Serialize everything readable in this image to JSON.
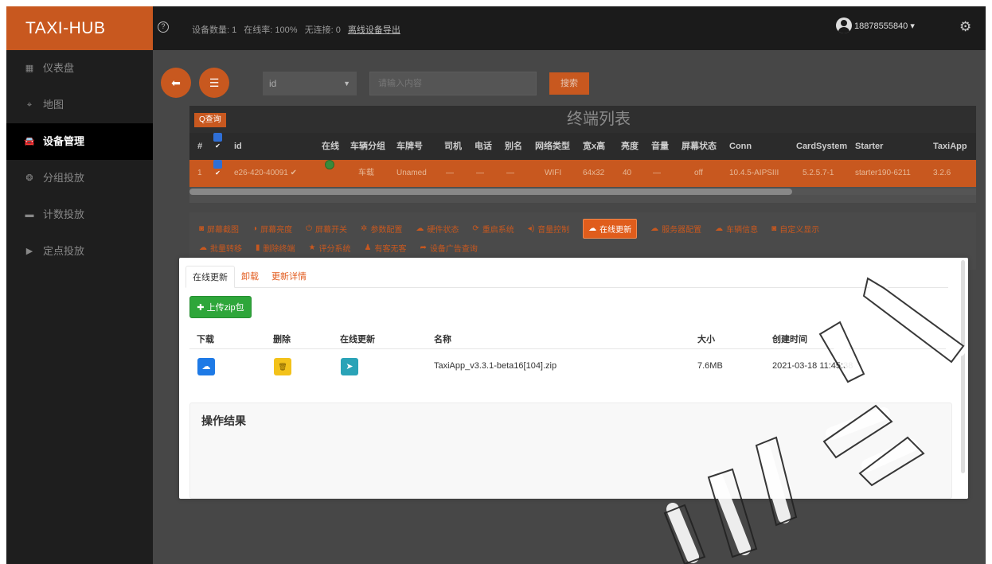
{
  "app": {
    "brand": "TAXI-HUB"
  },
  "header": {
    "device_count": "设备数量: 1",
    "online_rate": "在线率: 100%",
    "no_connect": "无连接: 0",
    "export_link": "离线设备导出",
    "user": "18878555840 ▾"
  },
  "sidebar": {
    "items": [
      {
        "label": "仪表盘",
        "icon": "dashboard-icon",
        "glyph": "▦"
      },
      {
        "label": "地图",
        "icon": "map-icon",
        "glyph": "⌖"
      },
      {
        "label": "设备管理",
        "icon": "car-icon",
        "glyph": "🚘"
      },
      {
        "label": "分组投放",
        "icon": "group-icon",
        "glyph": "❂"
      },
      {
        "label": "计数投放",
        "icon": "card-icon",
        "glyph": "▬"
      },
      {
        "label": "定点投放",
        "icon": "play-icon",
        "glyph": "▶"
      }
    ],
    "active_index": 2
  },
  "search": {
    "field_value": "id",
    "placeholder": "请输入内容",
    "button_label": "搜索"
  },
  "terminal_table": {
    "query_label": "Q查询",
    "title": "终端列表",
    "columns": [
      "#",
      "",
      "id",
      "在线",
      "车辆分组",
      "车牌号",
      "司机",
      "电话",
      "别名",
      "网络类型",
      "宽x高",
      "亮度",
      "音量",
      "屏幕状态",
      "Conn",
      "CardSystem",
      "Starter",
      "TaxiApp"
    ],
    "rows": [
      {
        "num": "1",
        "id": "e26-420-40091 ✔",
        "group": "车载",
        "plate": "Unamed",
        "driver": "—",
        "phone": "—",
        "alias": "—",
        "network": "WIFI",
        "size": "64x32",
        "brightness": "40",
        "volume": "—",
        "screen": "off",
        "conn": "10.4.5-AIPSIII",
        "cardsystem": "5.2.5.7-1",
        "starter": "starter190-6211",
        "taxiapp": "3.2.6"
      }
    ]
  },
  "toolbar": {
    "row1": [
      {
        "label": "屏幕截图",
        "glyph": "◙",
        "icon": "camera-icon"
      },
      {
        "label": "屏幕亮度",
        "glyph": "◑",
        "icon": "brightness-icon"
      },
      {
        "label": "屏幕开关",
        "glyph": "⏻",
        "icon": "power-icon"
      },
      {
        "label": "参数配置",
        "glyph": "✲",
        "icon": "settings-icon"
      },
      {
        "label": "硬件状态",
        "glyph": "☁",
        "icon": "cloud-icon"
      },
      {
        "label": "重启系统",
        "glyph": "⟳",
        "icon": "refresh-icon"
      },
      {
        "label": "音量控制",
        "glyph": "◂)",
        "icon": "volume-icon"
      },
      {
        "label": "在线更新",
        "glyph": "☁",
        "icon": "cloud-upload-icon",
        "active": true
      },
      {
        "label": "服务器配置",
        "glyph": "☁",
        "icon": "server-icon"
      },
      {
        "label": "车辆信息",
        "glyph": "☁",
        "icon": "vehicle-icon"
      },
      {
        "label": "自定义显示",
        "glyph": "◙",
        "icon": "display-icon"
      }
    ],
    "row2": [
      {
        "label": "批量转移",
        "glyph": "☁",
        "icon": "transfer-icon"
      },
      {
        "label": "删除终端",
        "glyph": "▮",
        "icon": "trash-icon"
      },
      {
        "label": "评分系统",
        "glyph": "★",
        "icon": "star-icon"
      },
      {
        "label": "有客无客",
        "glyph": "♟",
        "icon": "user-icon"
      },
      {
        "label": "设备广告查询",
        "glyph": "➦",
        "icon": "share-icon"
      }
    ]
  },
  "update_panel": {
    "tabs": [
      "在线更新",
      "卸载",
      "更新详情"
    ],
    "upload_label": "✚ 上传zip包",
    "columns": [
      "下载",
      "删除",
      "在线更新",
      "名称",
      "大小",
      "创建时间"
    ],
    "files": [
      {
        "name": "TaxiApp_v3.3.1-beta16[104].zip",
        "size": "7.6MB",
        "created": "2021-03-18 11:45:38"
      }
    ],
    "result_title": "操作结果"
  }
}
